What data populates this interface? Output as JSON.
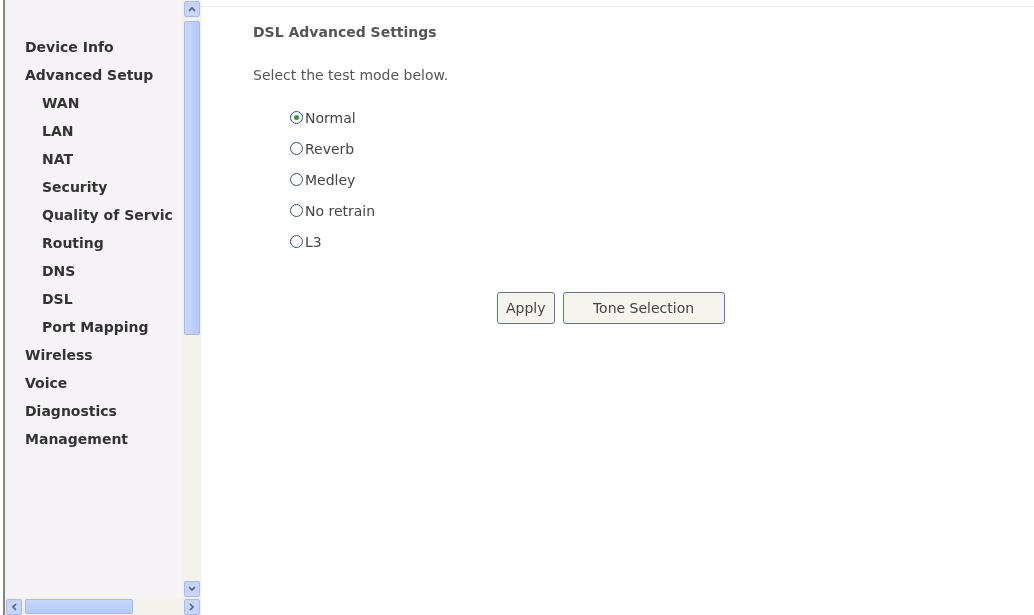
{
  "sidebar": {
    "items": [
      {
        "label": "Device Info"
      },
      {
        "label": "Advanced Setup",
        "children": [
          {
            "label": "WAN"
          },
          {
            "label": "LAN"
          },
          {
            "label": "NAT"
          },
          {
            "label": "Security"
          },
          {
            "label": "Quality of Servic"
          },
          {
            "label": "Routing"
          },
          {
            "label": "DNS"
          },
          {
            "label": "DSL"
          },
          {
            "label": "Port Mapping"
          }
        ]
      },
      {
        "label": "Wireless"
      },
      {
        "label": "Voice"
      },
      {
        "label": "Diagnostics"
      },
      {
        "label": "Management"
      }
    ]
  },
  "content": {
    "title": "DSL Advanced Settings",
    "instruction": "Select the test mode below.",
    "modes": [
      {
        "label": "Normal",
        "selected": true
      },
      {
        "label": "Reverb",
        "selected": false
      },
      {
        "label": "Medley",
        "selected": false
      },
      {
        "label": "No retrain",
        "selected": false
      },
      {
        "label": "L3",
        "selected": false
      }
    ],
    "buttons": [
      "Apply",
      "Tone Selection"
    ]
  }
}
